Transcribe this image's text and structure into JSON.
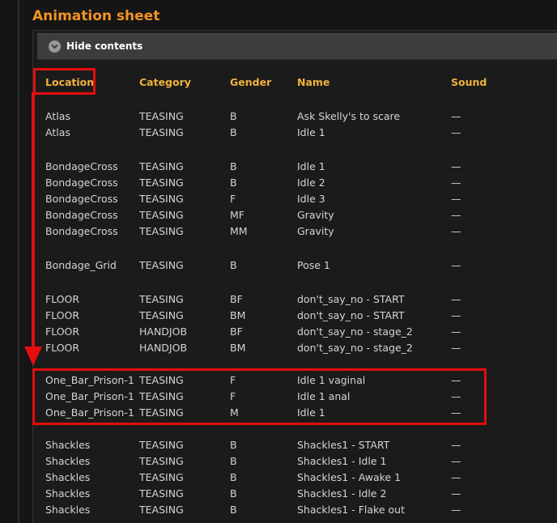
{
  "sheet": {
    "title": "Animation sheet",
    "toggle_label": "Hide contents"
  },
  "table": {
    "headers": [
      "Location",
      "Category",
      "Gender",
      "Name",
      "Sound"
    ],
    "rows": [
      {
        "location": "Atlas",
        "category": "TEASING",
        "gender": "B",
        "name": "Ask Skelly's to scare",
        "sound": "—"
      },
      {
        "location": "Atlas",
        "category": "TEASING",
        "gender": "B",
        "name": "Idle 1",
        "sound": "—"
      },
      {
        "location": "BondageCross",
        "category": "TEASING",
        "gender": "B",
        "name": "Idle 1",
        "sound": "—"
      },
      {
        "location": "BondageCross",
        "category": "TEASING",
        "gender": "B",
        "name": "Idle 2",
        "sound": "—"
      },
      {
        "location": "BondageCross",
        "category": "TEASING",
        "gender": "F",
        "name": "Idle 3",
        "sound": "—"
      },
      {
        "location": "BondageCross",
        "category": "TEASING",
        "gender": "MF",
        "name": "Gravity",
        "sound": "—"
      },
      {
        "location": "BondageCross",
        "category": "TEASING",
        "gender": "MM",
        "name": "Gravity",
        "sound": "—"
      },
      {
        "location": "Bondage_Grid",
        "category": "TEASING",
        "gender": "B",
        "name": "Pose 1",
        "sound": "—"
      },
      {
        "location": "FLOOR",
        "category": "TEASING",
        "gender": "BF",
        "name": "don't_say_no - START",
        "sound": "—"
      },
      {
        "location": "FLOOR",
        "category": "TEASING",
        "gender": "BM",
        "name": "don't_say_no - START",
        "sound": "—"
      },
      {
        "location": "FLOOR",
        "category": "HANDJOB",
        "gender": "BF",
        "name": "don't_say_no - stage_2",
        "sound": "—"
      },
      {
        "location": "FLOOR",
        "category": "HANDJOB",
        "gender": "BM",
        "name": "don't_say_no - stage_2",
        "sound": "—"
      },
      {
        "location": "One_Bar_Prison-1",
        "category": "TEASING",
        "gender": "F",
        "name": "Idle 1 vaginal",
        "sound": "—"
      },
      {
        "location": "One_Bar_Prison-1",
        "category": "TEASING",
        "gender": "F",
        "name": "Idle 1 anal",
        "sound": "—"
      },
      {
        "location": "One_Bar_Prison-1",
        "category": "TEASING",
        "gender": "M",
        "name": "Idle 1",
        "sound": "—"
      },
      {
        "location": "Shackles",
        "category": "TEASING",
        "gender": "B",
        "name": "Shackles1 - START",
        "sound": "—"
      },
      {
        "location": "Shackles",
        "category": "TEASING",
        "gender": "B",
        "name": "Shackles1 - Idle 1",
        "sound": "—"
      },
      {
        "location": "Shackles",
        "category": "TEASING",
        "gender": "B",
        "name": "Shackles1 - Awake 1",
        "sound": "—"
      },
      {
        "location": "Shackles",
        "category": "TEASING",
        "gender": "B",
        "name": "Shackles1 - Idle 2",
        "sound": "—"
      },
      {
        "location": "Shackles",
        "category": "TEASING",
        "gender": "B",
        "name": "Shackles1 - Flake out",
        "sound": "—"
      }
    ]
  },
  "colors": {
    "title": "#f29226",
    "header": "#f0b23c",
    "annotation": "#e50d0d"
  },
  "icons": {
    "toggle": "chevron-down-circle-icon",
    "annotation_arrow": "arrow-down-icon"
  }
}
